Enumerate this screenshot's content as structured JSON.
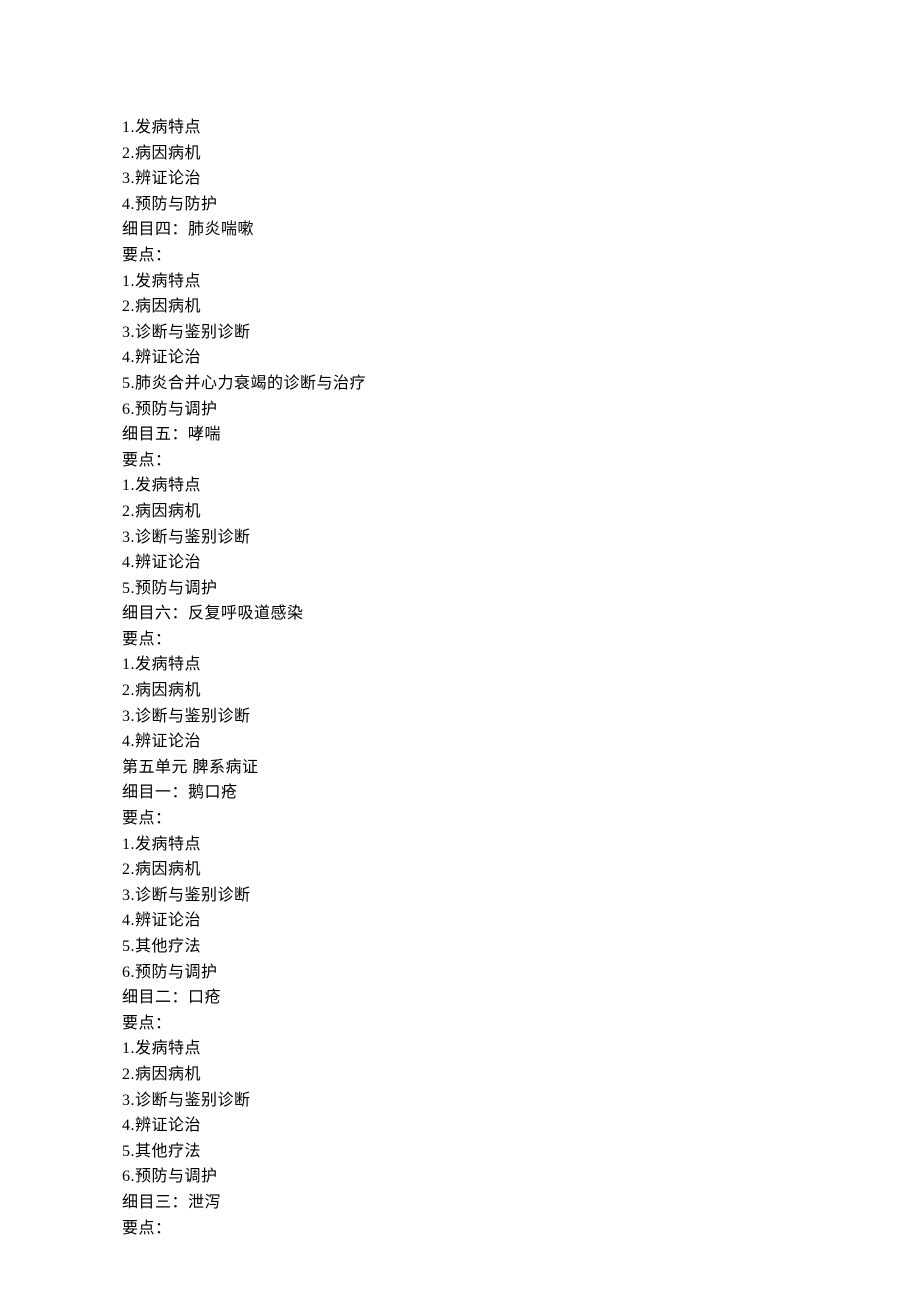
{
  "lines": [
    "1.发病特点",
    "2.病因病机",
    "3.辨证论治",
    "4.预防与防护",
    "细目四：肺炎喘嗽",
    "要点：",
    "1.发病特点",
    "2.病因病机",
    "3.诊断与鉴别诊断",
    "4.辨证论治",
    "5.肺炎合并心力衰竭的诊断与治疗",
    "6.预防与调护",
    "细目五：哮喘",
    "要点：",
    "1.发病特点",
    "2.病因病机",
    "3.诊断与鉴别诊断",
    "4.辨证论治",
    "5.预防与调护",
    "细目六：反复呼吸道感染",
    "要点：",
    "1.发病特点",
    "2.病因病机",
    "3.诊断与鉴别诊断",
    "4.辨证论治",
    "第五单元 脾系病证",
    "细目一：鹅口疮",
    "要点：",
    "1.发病特点",
    "2.病因病机",
    "3.诊断与鉴别诊断",
    "4.辨证论治",
    "5.其他疗法",
    "6.预防与调护",
    "细目二：口疮",
    "要点：",
    "1.发病特点",
    "2.病因病机",
    "3.诊断与鉴别诊断",
    "4.辨证论治",
    "5.其他疗法",
    "6.预防与调护",
    "细目三：泄泻",
    "要点："
  ]
}
